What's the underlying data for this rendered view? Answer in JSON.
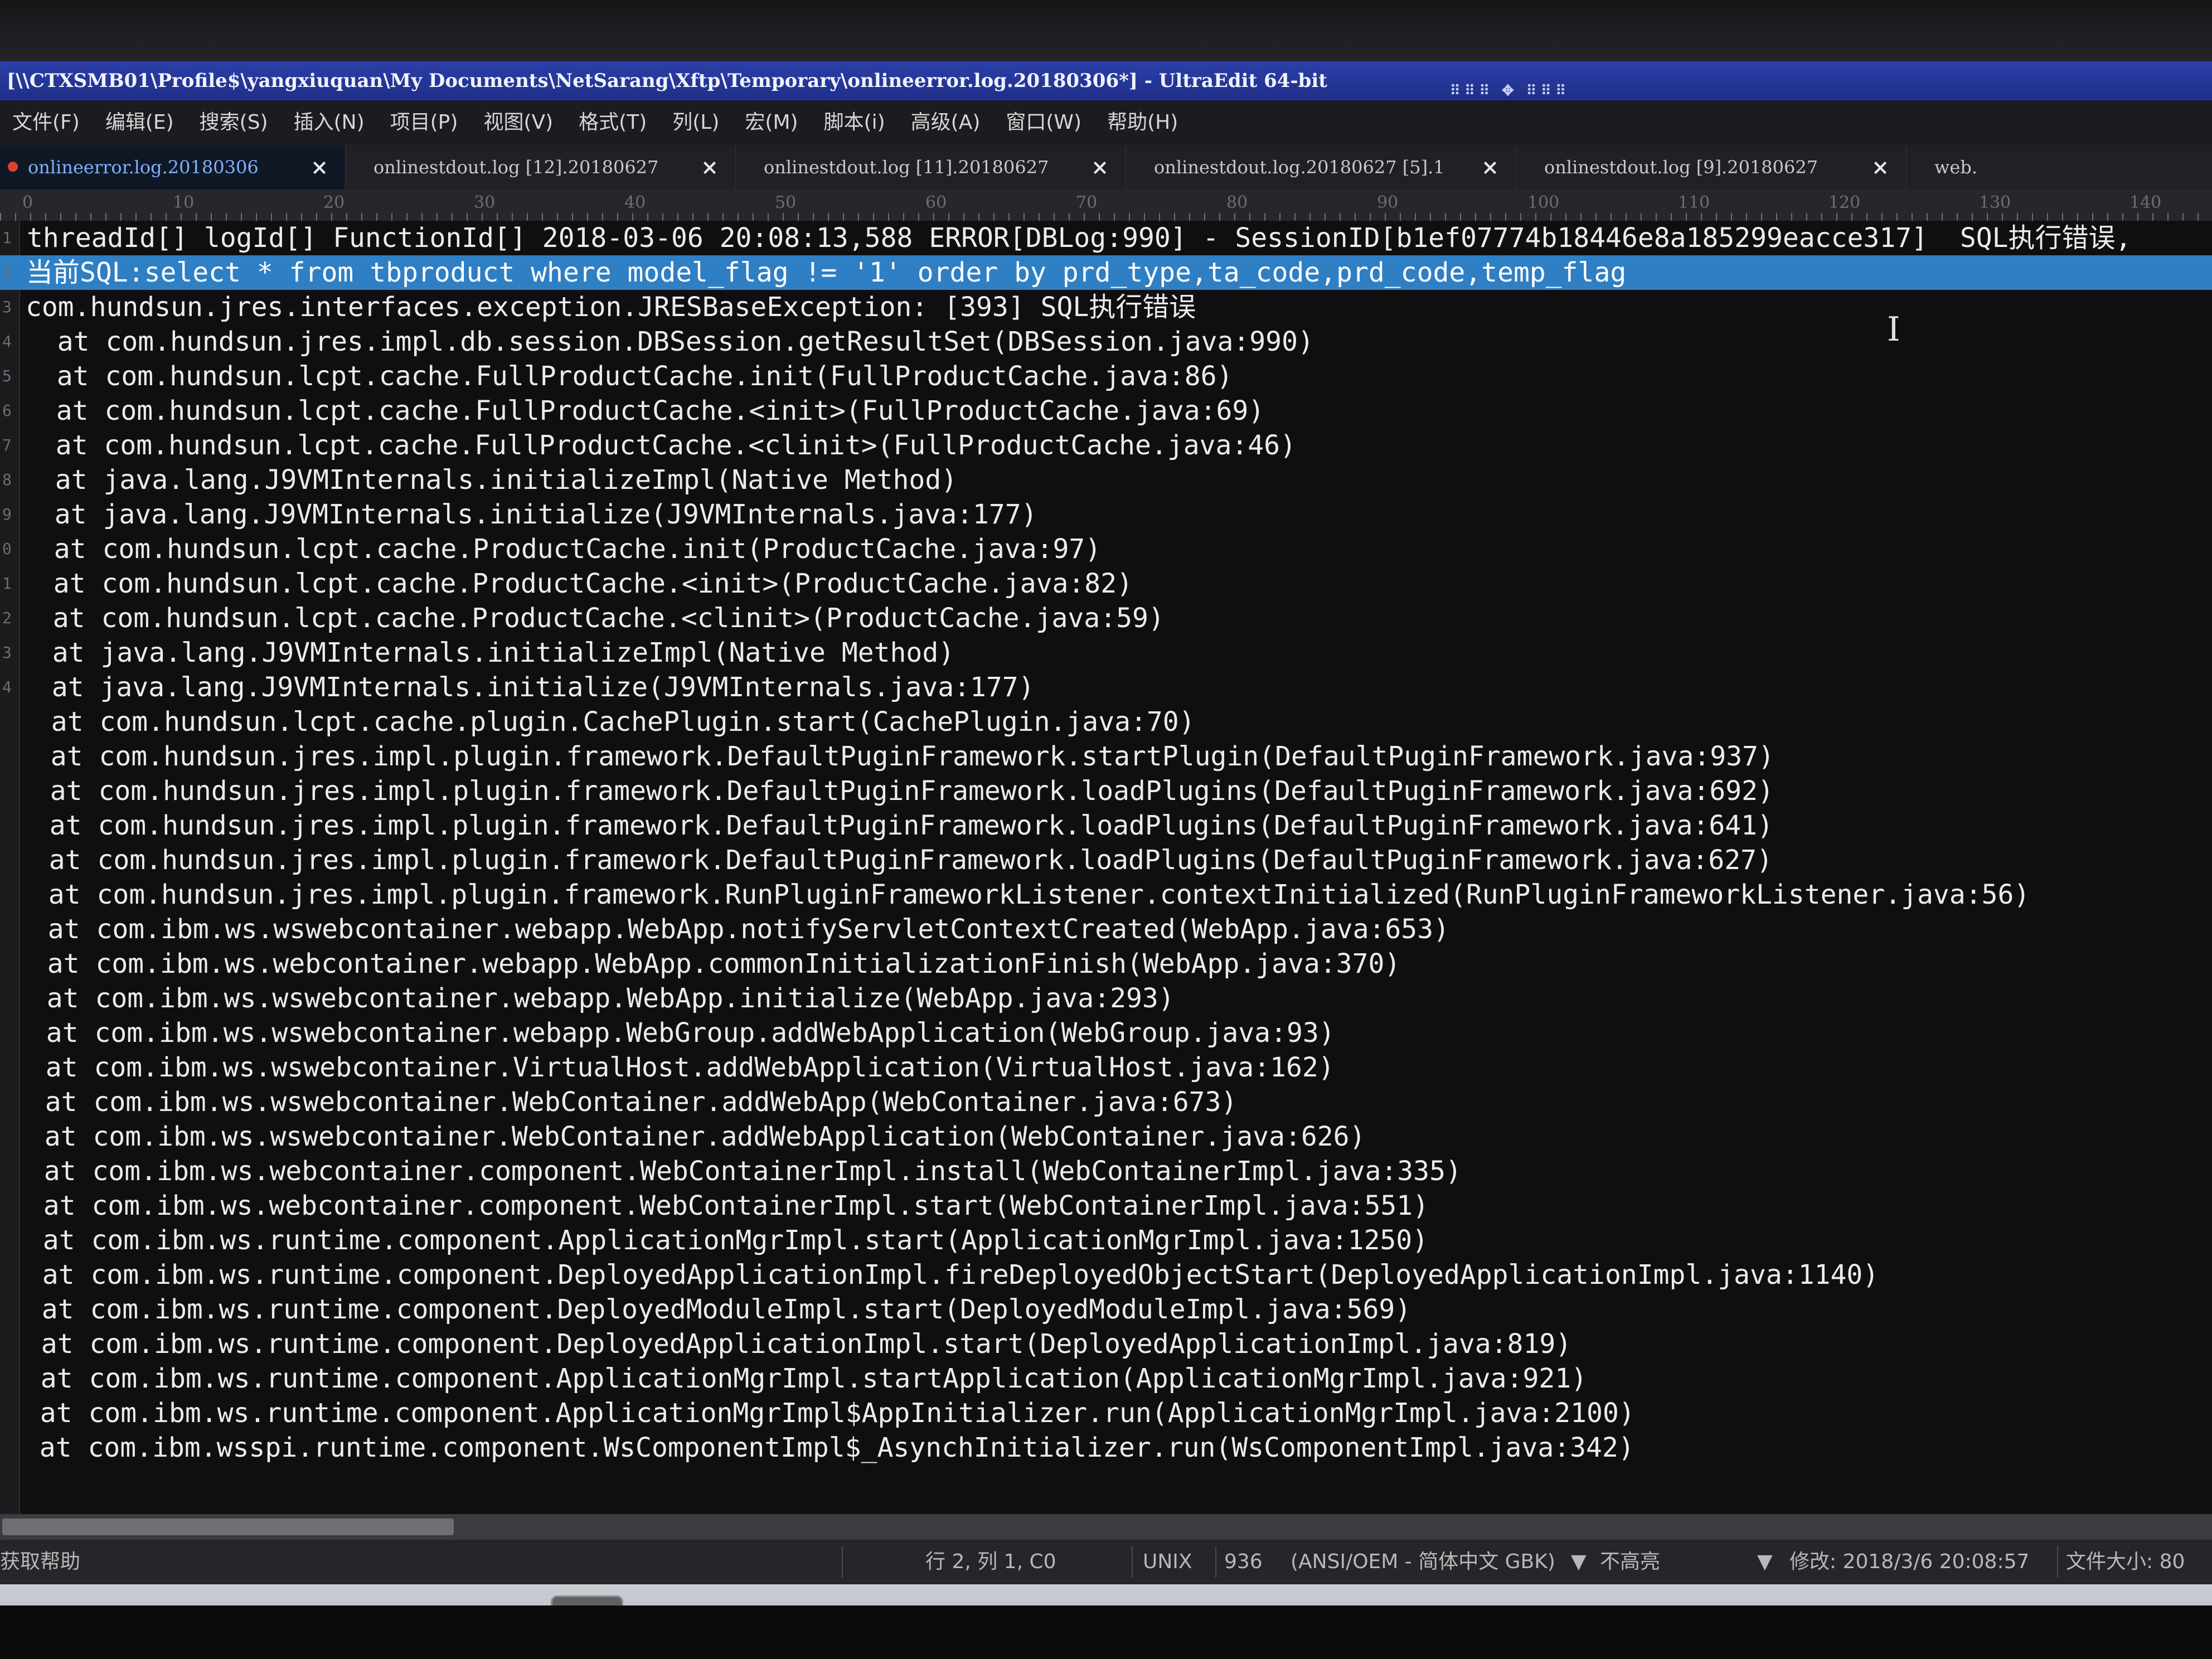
{
  "window": {
    "title": "[\\\\CTXSMB01\\Profile$\\yangxiuquan\\My Documents\\NetSarang\\Xftp\\Temporary\\onlineerror.log.20180306*] - UltraEdit 64-bit"
  },
  "menu": [
    "文件(F)",
    "编辑(E)",
    "搜索(S)",
    "插入(N)",
    "项目(P)",
    "视图(V)",
    "格式(T)",
    "列(L)",
    "宏(M)",
    "脚本(i)",
    "高级(A)",
    "窗口(W)",
    "帮助(H)"
  ],
  "tabs": [
    {
      "label": "onlineerror.log.20180306",
      "active": true
    },
    {
      "label": "onlinestdout.log [12].20180627",
      "active": false
    },
    {
      "label": "onlinestdout.log [11].20180627",
      "active": false
    },
    {
      "label": "onlinestdout.log.20180627 [5].1",
      "active": false
    },
    {
      "label": "onlinestdout.log [9].20180627",
      "active": false
    },
    {
      "label": "web.",
      "active": false
    }
  ],
  "ruler": [
    "0",
    "10",
    "20",
    "30",
    "40",
    "50",
    "60",
    "70",
    "80",
    "90",
    "100",
    "110",
    "120",
    "130",
    "140"
  ],
  "editor": {
    "selected_line": 2,
    "lines": [
      "threadId[] logId[] FunctionId[] 2018-03-06 20:08:13,588 ERROR[DBLog:990] - SessionID[b1ef07774b18446e8a185299eacce317]  SQL执行错误,",
      "当前SQL:select * from tbproduct where model_flag != '1' order by prd_type,ta_code,prd_code,temp_flag",
      "com.hundsun.jres.interfaces.exception.JRESBaseException: [393] SQL执行错误",
      "  at com.hundsun.jres.impl.db.session.DBSession.getResultSet(DBSession.java:990)",
      "  at com.hundsun.lcpt.cache.FullProductCache.init(FullProductCache.java:86)",
      "  at com.hundsun.lcpt.cache.FullProductCache.<init>(FullProductCache.java:69)",
      "  at com.hundsun.lcpt.cache.FullProductCache.<clinit>(FullProductCache.java:46)",
      "  at java.lang.J9VMInternals.initializeImpl(Native Method)",
      "  at java.lang.J9VMInternals.initialize(J9VMInternals.java:177)",
      "  at com.hundsun.lcpt.cache.ProductCache.init(ProductCache.java:97)",
      "  at com.hundsun.lcpt.cache.ProductCache.<init>(ProductCache.java:82)",
      "  at com.hundsun.lcpt.cache.ProductCache.<clinit>(ProductCache.java:59)",
      "  at java.lang.J9VMInternals.initializeImpl(Native Method)",
      "  at java.lang.J9VMInternals.initialize(J9VMInternals.java:177)",
      "  at com.hundsun.lcpt.cache.plugin.CachePlugin.start(CachePlugin.java:70)",
      "  at com.hundsun.jres.impl.plugin.framework.DefaultPuginFramework.startPlugin(DefaultPuginFramework.java:937)",
      "  at com.hundsun.jres.impl.plugin.framework.DefaultPuginFramework.loadPlugins(DefaultPuginFramework.java:692)",
      "  at com.hundsun.jres.impl.plugin.framework.DefaultPuginFramework.loadPlugins(DefaultPuginFramework.java:641)",
      "  at com.hundsun.jres.impl.plugin.framework.DefaultPuginFramework.loadPlugins(DefaultPuginFramework.java:627)",
      "  at com.hundsun.jres.impl.plugin.framework.RunPluginFrameworkListener.contextInitialized(RunPluginFrameworkListener.java:56)",
      "  at com.ibm.ws.wswebcontainer.webapp.WebApp.notifyServletContextCreated(WebApp.java:653)",
      "  at com.ibm.ws.webcontainer.webapp.WebApp.commonInitializationFinish(WebApp.java:370)",
      "  at com.ibm.ws.wswebcontainer.webapp.WebApp.initialize(WebApp.java:293)",
      "  at com.ibm.ws.wswebcontainer.webapp.WebGroup.addWebApplication(WebGroup.java:93)",
      "  at com.ibm.ws.wswebcontainer.VirtualHost.addWebApplication(VirtualHost.java:162)",
      "  at com.ibm.ws.wswebcontainer.WebContainer.addWebApp(WebContainer.java:673)",
      "  at com.ibm.ws.wswebcontainer.WebContainer.addWebApplication(WebContainer.java:626)",
      "  at com.ibm.ws.webcontainer.component.WebContainerImpl.install(WebContainerImpl.java:335)",
      "  at com.ibm.ws.webcontainer.component.WebContainerImpl.start(WebContainerImpl.java:551)",
      "  at com.ibm.ws.runtime.component.ApplicationMgrImpl.start(ApplicationMgrImpl.java:1250)",
      "  at com.ibm.ws.runtime.component.DeployedApplicationImpl.fireDeployedObjectStart(DeployedApplicationImpl.java:1140)",
      "  at com.ibm.ws.runtime.component.DeployedModuleImpl.start(DeployedModuleImpl.java:569)",
      "  at com.ibm.ws.runtime.component.DeployedApplicationImpl.start(DeployedApplicationImpl.java:819)",
      "  at com.ibm.ws.runtime.component.ApplicationMgrImpl.startApplication(ApplicationMgrImpl.java:921)",
      "  at com.ibm.ws.runtime.component.ApplicationMgrImpl$AppInitializer.run(ApplicationMgrImpl.java:2100)",
      "  at com.ibm.wsspi.runtime.component.WsComponentImpl$_AsynchInitializer.run(WsComponentImpl.java:342)"
    ],
    "line_numbers": [
      "1",
      "2",
      "3",
      "4",
      "5",
      "6",
      "7",
      "8",
      "9",
      "0",
      "1",
      "2",
      "3",
      "4"
    ]
  },
  "status": {
    "help": "获取帮助",
    "position": "行 2, 列 1, C0",
    "line_ending": "UNIX",
    "codepage": "936",
    "encoding": "(ANSI/OEM - 简体中文 GBK)",
    "highlight": "不高亮",
    "modified": "修改:  2018/3/6 20:08:57",
    "filesize": "文件大小:  80"
  },
  "taskbar": [
    {
      "name": "chrome-icon",
      "glyph": "◉",
      "color": "#d9382c"
    },
    {
      "name": "internet-explorer-icon",
      "glyph": "e",
      "color": "#2f8fe0"
    },
    {
      "name": "browser-globe-icon",
      "glyph": "◐",
      "color": "#2257c9"
    },
    {
      "name": "green-app-icon",
      "glyph": "✎",
      "color": "#6a9a1a"
    },
    {
      "name": "qq-messenger-icon",
      "glyph": "☺",
      "color": "#d2a414"
    },
    {
      "name": "swirl-app-icon",
      "glyph": "@",
      "color": "#d8372c"
    },
    {
      "name": "ultraedit-icon",
      "glyph": "UE",
      "color": "#1f1f1f",
      "active": true
    }
  ],
  "colors": {
    "title_bar": "#2436a0",
    "selection": "#2f7fc4",
    "editor_bg": "#0f0f10",
    "text": "#ececec"
  }
}
